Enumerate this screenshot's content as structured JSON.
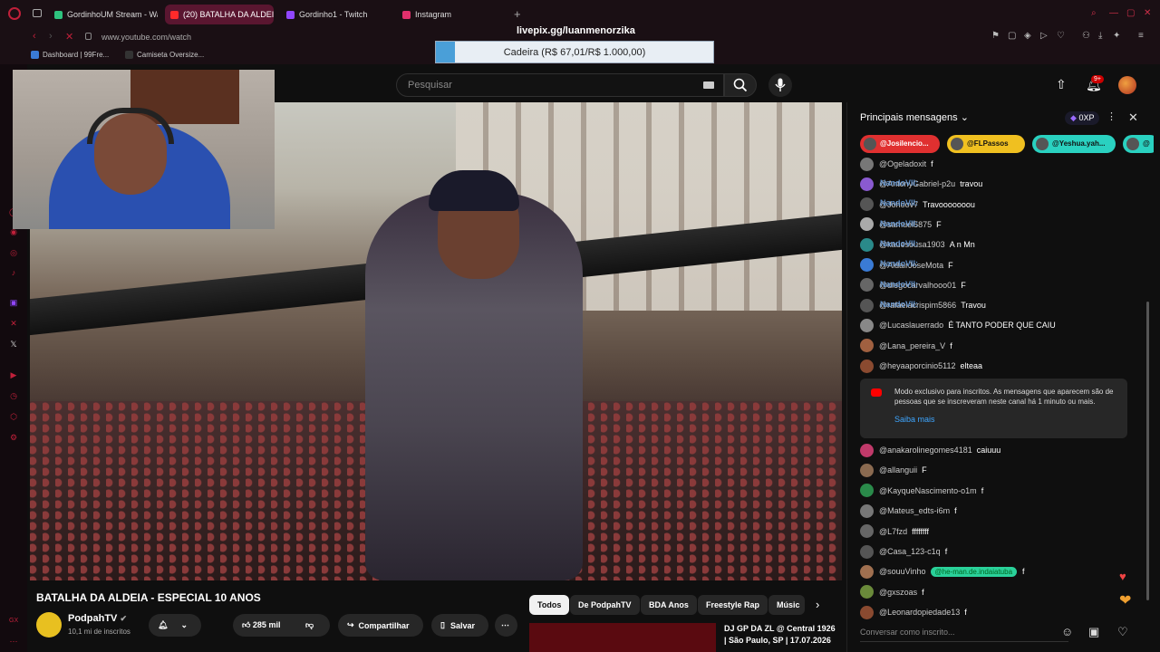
{
  "browser": {
    "tabs": [
      {
        "label": "GordinhoUM Stream - Watc",
        "color": "#2ec27e",
        "active": false
      },
      {
        "label": "(20) BATALHA DA ALDEIA",
        "color": "#ff2a2a",
        "active": true
      },
      {
        "label": "Gordinho1 - Twitch",
        "color": "#9146ff",
        "active": false
      },
      {
        "label": "Instagram",
        "color": "#e1306c",
        "active": false
      }
    ],
    "new_tab": "+",
    "url": "www.youtube.com/watch",
    "bookmarks": [
      {
        "label": "Dashboard | 99Fre...",
        "color": "#3a7bd5"
      },
      {
        "label": "Camiseta Oversize...",
        "color": "#222"
      }
    ]
  },
  "overlay": {
    "pix_url": "livepix.gg/luanmenorzika",
    "goal_label": "Cadeira (R$ 67,01/R$ 1.000,00)",
    "goal_progress": 0.067
  },
  "youtube": {
    "search_placeholder": "Pesquisar",
    "notification_count": "9+"
  },
  "video": {
    "title": "BATALHA DA ALDEIA - ESPECIAL 10 ANOS",
    "channel": "PodpahTV",
    "subscribers": "10,1 mi de inscritos",
    "likes": "285 mil",
    "share": "Compartilhar",
    "save": "Salvar"
  },
  "chips": [
    "Todos",
    "De PodpahTV",
    "BDA Anos",
    "Freestyle Rap",
    "Músic"
  ],
  "related": {
    "title_line1": "DJ GP DA ZL @ Central 1926",
    "title_line2": "| São Paulo, SP | 17.07.2026"
  },
  "chat": {
    "header": "Principais mensagens",
    "xp": "0XP",
    "tickers": [
      {
        "name": "@Josilencio...",
        "color": "#e03030"
      },
      {
        "name": "@FLPassos",
        "color": "#f0c020"
      },
      {
        "name": "@Yeshua.yah...",
        "color": "#2ad1c0"
      },
      {
        "name": "@",
        "color": "#2ad1c0"
      }
    ],
    "messages_top": [
      {
        "author": "@Ogeladoxit",
        "text": "f",
        "color": "#777"
      },
      {
        "author": "@AntonyGabriel-p2u",
        "text": "travou",
        "color": "#8a5ad0"
      },
      {
        "author": "@Johoov7",
        "text": "Travooooooou",
        "color": "#555"
      },
      {
        "author": "@samuel5875",
        "text": "F",
        "color": "#aaa"
      },
      {
        "author": "@kauesousa1903",
        "text": "A n Mn",
        "color": "#2a8a8a"
      },
      {
        "author": "@AldairJoseMota",
        "text": "F",
        "color": "#3a7bd5"
      },
      {
        "author": "@diegocarvalhooo01",
        "text": "F",
        "color": "#666"
      },
      {
        "author": "@rafaelacrispim5866",
        "text": "Travou",
        "color": "#555"
      },
      {
        "author": "@Lucaslauerrado",
        "text": "É TANTO PODER QUE CAIU",
        "color": "#888"
      },
      {
        "author": "@Lana_pereira_V",
        "text": "f",
        "color": "#a06040"
      },
      {
        "author": "@heyaaporcinio5112",
        "text": "elteaa",
        "color": "#8a4a30"
      }
    ],
    "ghost_names": [
      "NandoVII:",
      "NandoVII:",
      "NandoVII:",
      "NandoVII:",
      "NandoVII:",
      "NandoVII:",
      "NandoVII:"
    ],
    "notice_text": "Modo exclusivo para inscritos. As mensagens que aparecem são de pessoas que se inscreveram neste canal há 1 minuto ou mais.",
    "notice_link": "Saiba mais",
    "messages_bottom": [
      {
        "author": "@anakarolinegomes4181",
        "text": "caiuuu",
        "color": "#c03a6a"
      },
      {
        "author": "@allanguii",
        "text": "F",
        "color": "#8a6a50"
      },
      {
        "author": "@KayqueNascimento-o1m",
        "text": "f",
        "color": "#2a8a4a"
      },
      {
        "author": "@Mateus_edts-i6m",
        "text": "f",
        "color": "#777"
      },
      {
        "author": "@L7fzd",
        "text": "ffffffff",
        "color": "#666"
      },
      {
        "author": "@Casa_123-c1q",
        "text": "f",
        "color": "#555"
      },
      {
        "author": "@souuVinho",
        "text": "f",
        "color": "#a07050",
        "badge": "@he-man.de.indaiatuba"
      },
      {
        "author": "@gxszoas",
        "text": "f",
        "color": "#6a8a3a"
      },
      {
        "author": "@Leonardopiedade13",
        "text": "f",
        "color": "#8a4a30"
      }
    ],
    "input_placeholder": "Conversar como inscrito..."
  }
}
